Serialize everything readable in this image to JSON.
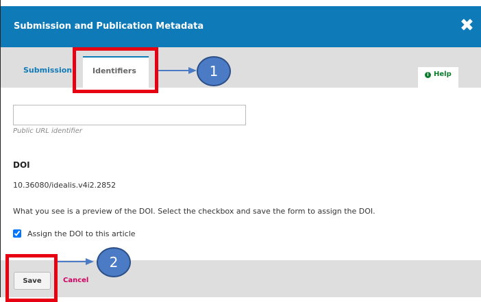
{
  "modal": {
    "title": "Submission and Publication Metadata",
    "close_icon": "close-icon"
  },
  "tabs": [
    {
      "label": "Submission",
      "active": false
    },
    {
      "label": "Identifiers",
      "active": true
    }
  ],
  "help": {
    "label": "Help",
    "icon": "info-icon"
  },
  "url_field": {
    "value": "",
    "description": "Public URL identifier"
  },
  "doi": {
    "heading": "DOI",
    "value": "10.36080/idealis.v4i2.2852",
    "note": "What you see is a preview of the DOI. Select the checkbox and save the form to assign the DOI.",
    "assign_label": "Assign the DOI to this article",
    "assign_checked": true
  },
  "footer": {
    "save_label": "Save",
    "cancel_label": "Cancel"
  },
  "annotations": {
    "callout1": "1",
    "callout2": "2",
    "highlight_color": "#e60012",
    "callout_color": "#4b7bc4"
  },
  "colors": {
    "header": "#0f7ab8",
    "help": "#0a7c2a",
    "cancel": "#d00060"
  }
}
